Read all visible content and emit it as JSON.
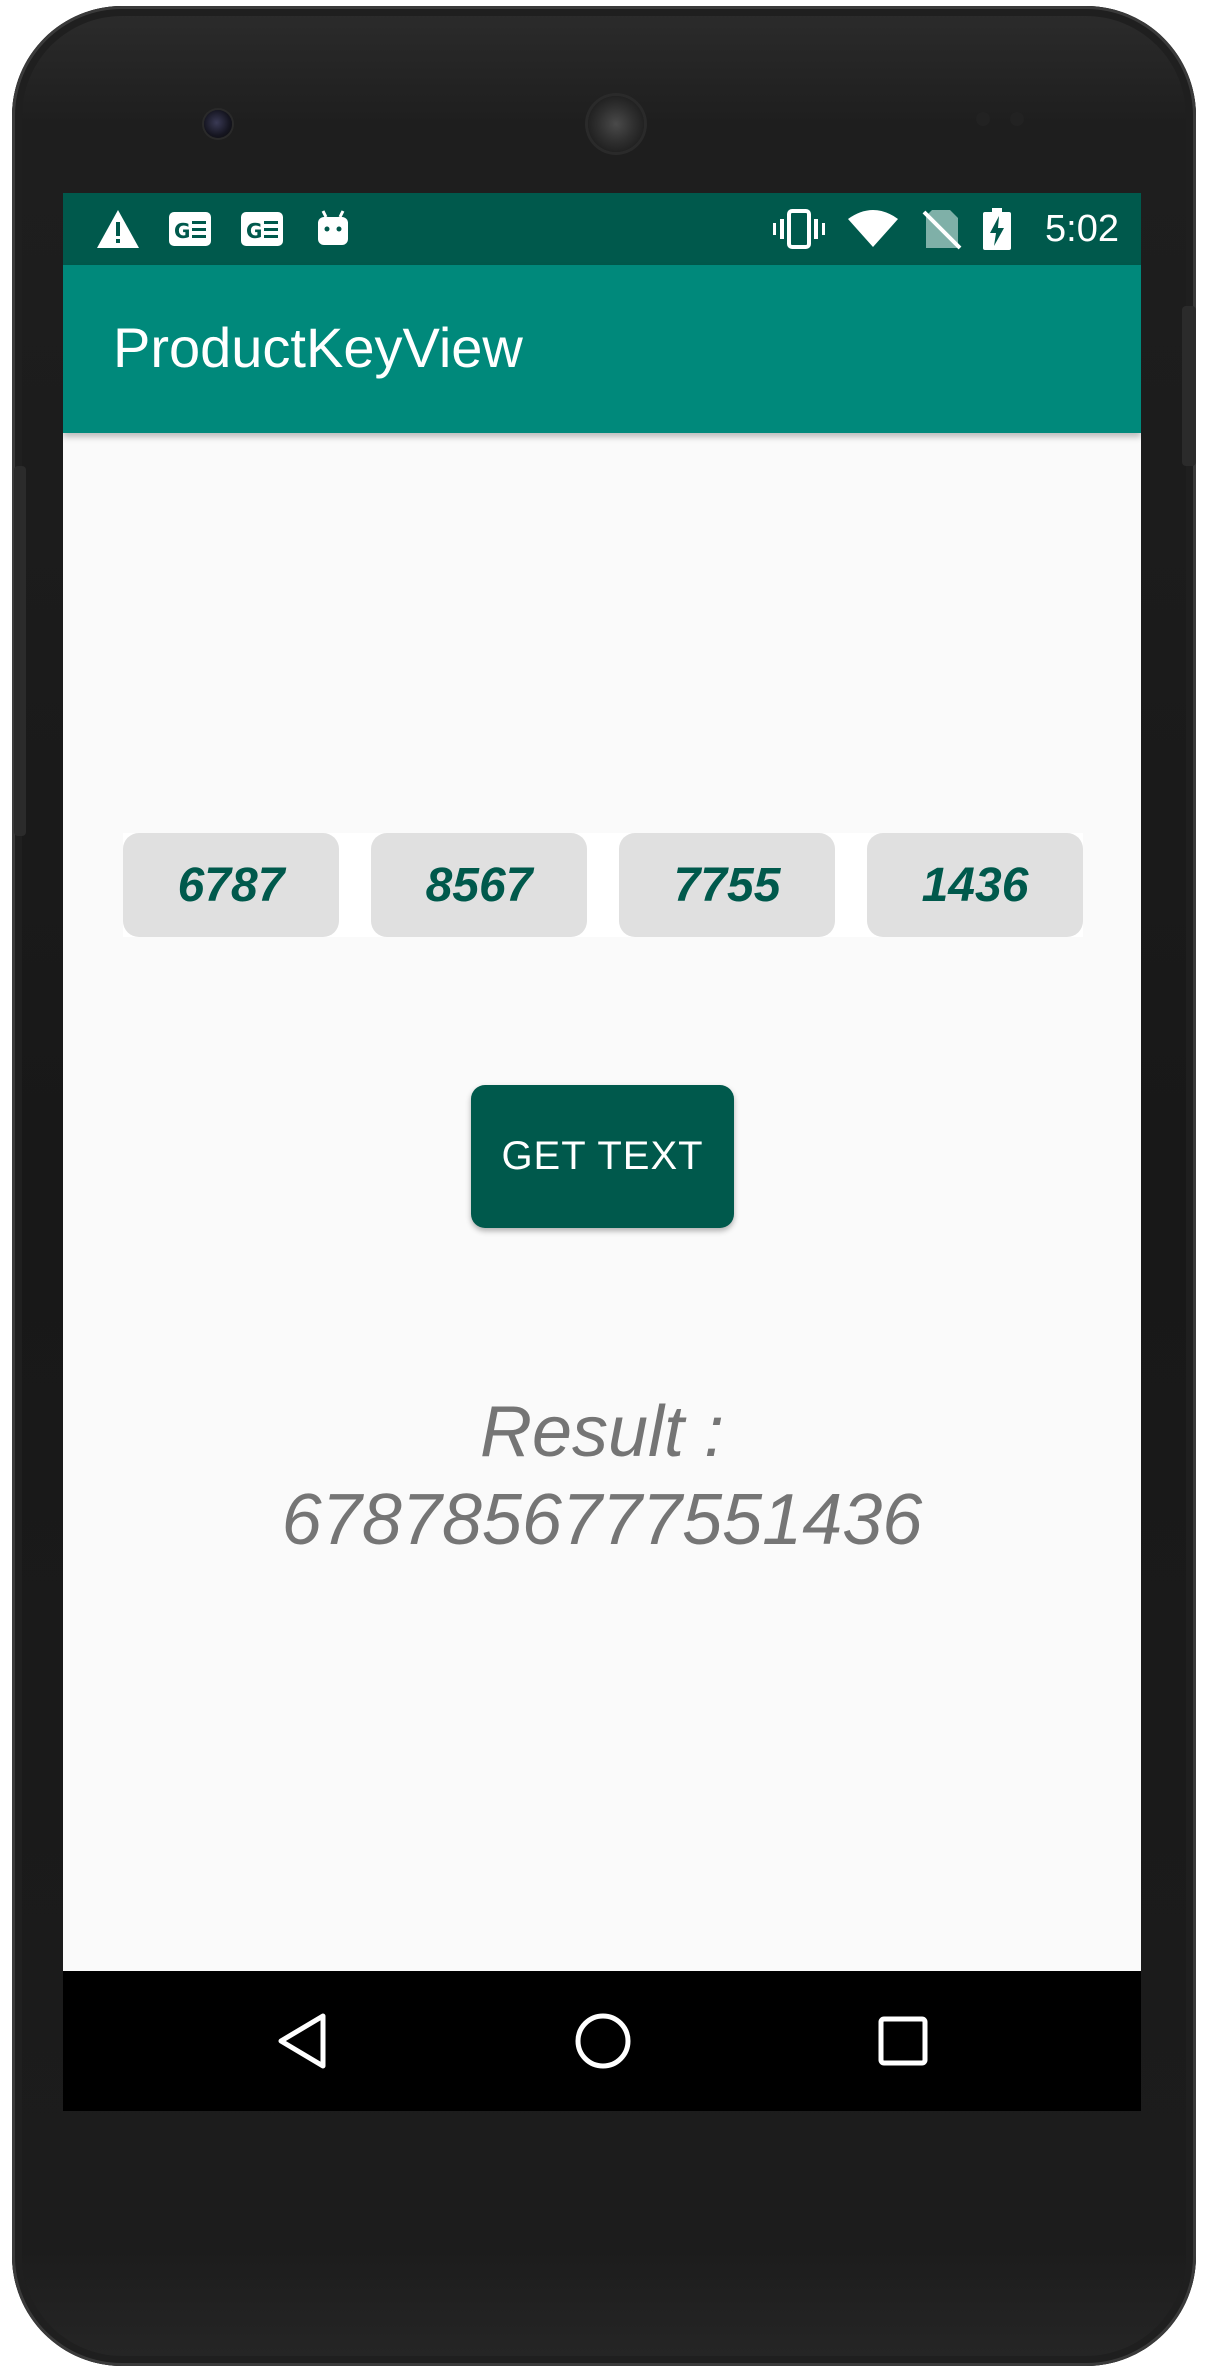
{
  "status_bar": {
    "time": "5:02",
    "icons": [
      "warning-icon",
      "ge-icon",
      "ge-icon",
      "android-icon",
      "vibrate-icon",
      "wifi-icon",
      "no-sim-icon",
      "battery-charging-icon"
    ]
  },
  "app_bar": {
    "title": "ProductKeyView"
  },
  "product_key": {
    "segments": [
      "6787",
      "8567",
      "7755",
      "1436"
    ]
  },
  "actions": {
    "get_text_label": "GET TEXT"
  },
  "result": {
    "label": "Result :",
    "value": "6787856777551436"
  },
  "nav_bar": {
    "icons": [
      "back-icon",
      "home-icon",
      "recents-icon"
    ]
  },
  "colors": {
    "status_bar": "#00594c",
    "app_bar": "#00897b",
    "accent": "#00594c",
    "key_box": "#e0e0e0",
    "result_text": "#757575"
  }
}
